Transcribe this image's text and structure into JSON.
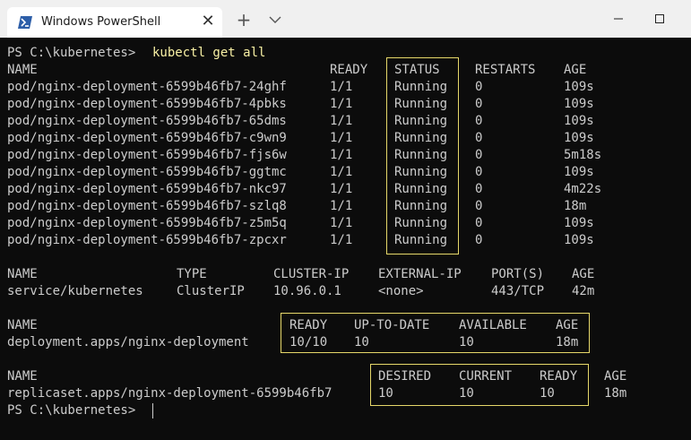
{
  "window": {
    "tab_title": "Windows PowerShell",
    "tab_close": "✕",
    "new_tab": "+"
  },
  "terminal": {
    "prompt": "PS C:\\kubernetes> ",
    "command": "kubectl get all",
    "pods": {
      "headers": [
        "NAME",
        "READY",
        "STATUS",
        "RESTARTS",
        "AGE"
      ],
      "rows": [
        [
          "pod/nginx-deployment-6599b46fb7-24ghf",
          "1/1",
          "Running",
          "0",
          "109s"
        ],
        [
          "pod/nginx-deployment-6599b46fb7-4pbks",
          "1/1",
          "Running",
          "0",
          "109s"
        ],
        [
          "pod/nginx-deployment-6599b46fb7-65dms",
          "1/1",
          "Running",
          "0",
          "109s"
        ],
        [
          "pod/nginx-deployment-6599b46fb7-c9wn9",
          "1/1",
          "Running",
          "0",
          "109s"
        ],
        [
          "pod/nginx-deployment-6599b46fb7-fjs6w",
          "1/1",
          "Running",
          "0",
          "5m18s"
        ],
        [
          "pod/nginx-deployment-6599b46fb7-ggtmc",
          "1/1",
          "Running",
          "0",
          "109s"
        ],
        [
          "pod/nginx-deployment-6599b46fb7-nkc97",
          "1/1",
          "Running",
          "0",
          "4m22s"
        ],
        [
          "pod/nginx-deployment-6599b46fb7-szlq8",
          "1/1",
          "Running",
          "0",
          "18m"
        ],
        [
          "pod/nginx-deployment-6599b46fb7-z5m5q",
          "1/1",
          "Running",
          "0",
          "109s"
        ],
        [
          "pod/nginx-deployment-6599b46fb7-zpcxr",
          "1/1",
          "Running",
          "0",
          "109s"
        ]
      ]
    },
    "services": {
      "headers": [
        "NAME",
        "TYPE",
        "CLUSTER-IP",
        "EXTERNAL-IP",
        "PORT(S)",
        "AGE"
      ],
      "rows": [
        [
          "service/kubernetes",
          "ClusterIP",
          "10.96.0.1",
          "<none>",
          "443/TCP",
          "42m"
        ]
      ]
    },
    "deployments": {
      "headers": [
        "NAME",
        "READY",
        "UP-TO-DATE",
        "AVAILABLE",
        "AGE"
      ],
      "rows": [
        [
          "deployment.apps/nginx-deployment",
          "10/10",
          "10",
          "10",
          "18m"
        ]
      ]
    },
    "replicasets": {
      "headers": [
        "NAME",
        "DESIRED",
        "CURRENT",
        "READY",
        "AGE"
      ],
      "rows": [
        [
          "replicaset.apps/nginx-deployment-6599b46fb7",
          "10",
          "10",
          "10",
          "18m"
        ]
      ]
    },
    "final_prompt": "PS C:\\kubernetes> "
  },
  "colors": {
    "background": "#0c0c0c",
    "text": "#cccccc",
    "command": "#f9f1a5",
    "highlight_border": "#e6d86a"
  }
}
